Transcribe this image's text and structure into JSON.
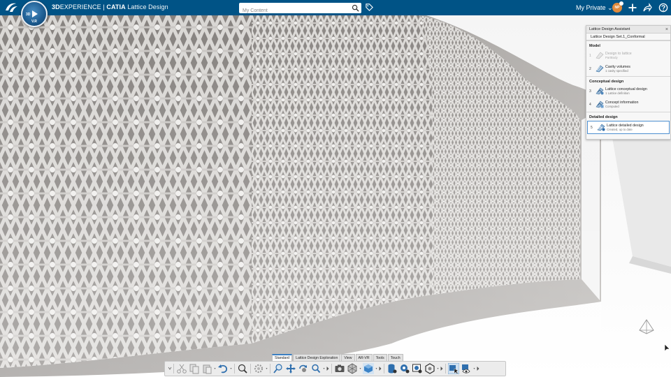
{
  "header": {
    "brand_bold": "3D",
    "brand_rest": "EXPERIENCE | ",
    "product": "CATIA",
    "app_name": "Lattice Design",
    "compass_version": "V.R",
    "compass_quad_label": "3D",
    "search_placeholder": "My Content",
    "collab_space": "My Private",
    "avatar_initials": "NP"
  },
  "panel": {
    "title": "Lattice Design Assistant",
    "set_name": "Lattice Design Set.1_Conformal",
    "sections": [
      {
        "title": "Model",
        "steps": [
          {
            "num": "1",
            "label": "Design to lattice",
            "status": "PartBody",
            "icon": "design-to-lattice-icon",
            "enabled": false
          },
          {
            "num": "2",
            "label": "Cavity volumes",
            "status": "1 cavity specified",
            "icon": "cavity-volumes-icon",
            "enabled": true
          }
        ]
      },
      {
        "title": "Conceptual design",
        "steps": [
          {
            "num": "3",
            "label": "Lattice conceptual design",
            "status": "1 Lattice definition",
            "icon": "lattice-conceptual-design-icon",
            "enabled": true
          },
          {
            "num": "4",
            "label": "Concept information",
            "status": "Computed",
            "icon": "concept-information-icon",
            "enabled": true
          }
        ]
      },
      {
        "title": "Detailed design",
        "steps": [
          {
            "num": "5",
            "label": "Lattice detailed design",
            "status": "Created, up to date",
            "icon": "lattice-detailed-design-icon",
            "enabled": true,
            "active": true
          }
        ]
      }
    ]
  },
  "action_tabs": [
    "Standard",
    "Lattice Design Exploration",
    "View",
    "AR-VR",
    "Tools",
    "Touch"
  ],
  "active_tab": "Standard",
  "colors": {
    "topbar": "#005386",
    "accent": "#3a7fc2",
    "lattice_dark": "#6f6c69",
    "lattice_light": "#d7d5d2"
  }
}
